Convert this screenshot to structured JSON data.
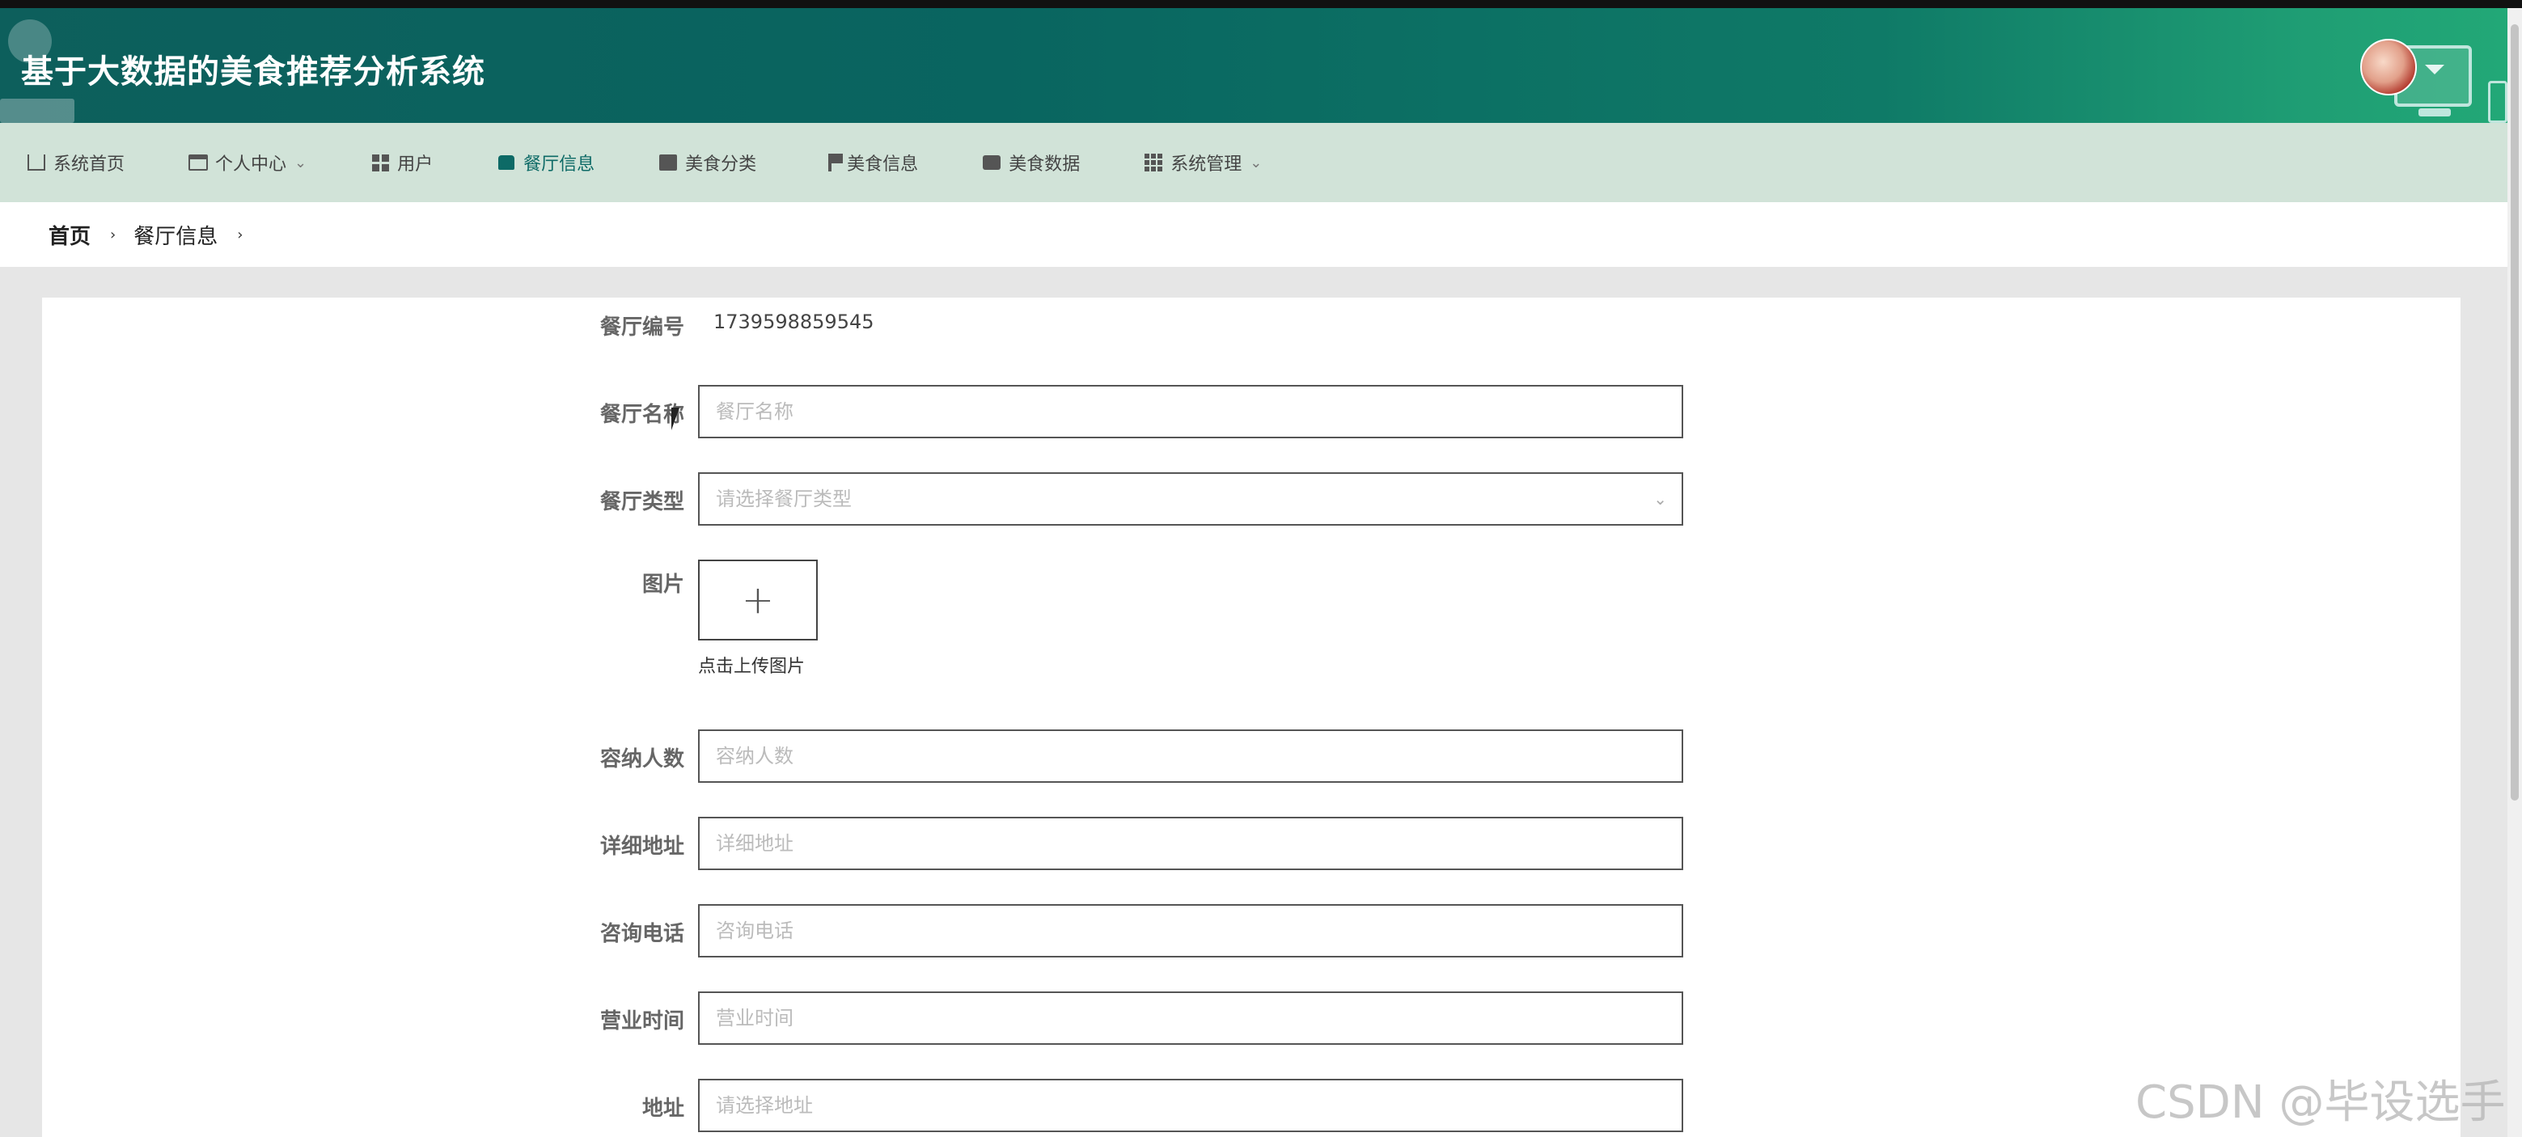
{
  "app": {
    "title": "基于大数据的美食推荐分析系统"
  },
  "nav": {
    "items": [
      {
        "label": "系统首页",
        "icon": "home-icon",
        "dropdown": false
      },
      {
        "label": "个人中心",
        "icon": "card-icon",
        "dropdown": true
      },
      {
        "label": "用户",
        "icon": "grid-icon",
        "dropdown": false
      },
      {
        "label": "餐厅信息",
        "icon": "restaurant-icon",
        "dropdown": false,
        "active": true
      },
      {
        "label": "美食分类",
        "icon": "chart-icon",
        "dropdown": false
      },
      {
        "label": "美食信息",
        "icon": "flag-icon",
        "dropdown": false
      },
      {
        "label": "美食数据",
        "icon": "chat-icon",
        "dropdown": false
      },
      {
        "label": "系统管理",
        "icon": "apps-icon",
        "dropdown": true
      }
    ]
  },
  "breadcrumb": {
    "home": "首页",
    "current": "餐厅信息",
    "separator": "›"
  },
  "form": {
    "restaurant_id": {
      "label": "餐厅编号",
      "value": "1739598859545"
    },
    "restaurant_name": {
      "label": "餐厅名称",
      "placeholder": "餐厅名称"
    },
    "restaurant_type": {
      "label": "餐厅类型",
      "placeholder": "请选择餐厅类型"
    },
    "image": {
      "label": "图片",
      "upload_hint": "点击上传图片",
      "plus": "+"
    },
    "capacity": {
      "label": "容纳人数",
      "placeholder": "容纳人数"
    },
    "detail_address": {
      "label": "详细地址",
      "placeholder": "详细地址"
    },
    "phone": {
      "label": "咨询电话",
      "placeholder": "咨询电话"
    },
    "hours": {
      "label": "营业时间",
      "placeholder": "营业时间"
    },
    "address": {
      "label": "地址",
      "placeholder": "请选择地址"
    }
  },
  "watermark": "CSDN @毕设选手",
  "colors": {
    "header_start": "#0d5f5c",
    "header_end": "#22a877",
    "nav_bg": "#d1e3d8",
    "active_nav": "#0d6a66"
  }
}
